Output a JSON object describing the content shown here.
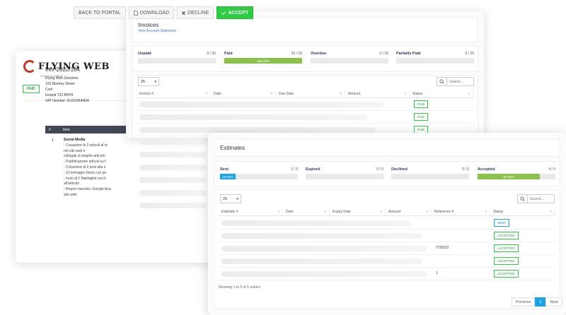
{
  "toolbar": {
    "back_label": "BACK TO PORTAL",
    "download_label": "DOWNLOAD",
    "decline_label": "DECLINE",
    "accept_label": "ACCEPT"
  },
  "invoice_doc": {
    "logo_text": "FLYING WEB",
    "logo_sub": "SOLUTIONS",
    "status": "PAID",
    "number": "INV-2022/104",
    "company_name": "Flying Web Solutions",
    "address_lines": [
      "103 Blarney Street",
      "Cork",
      "Ireland T23 R8Y8",
      "VAT Number: IE1020644DA"
    ],
    "table_headers": [
      "#",
      "Item"
    ],
    "row_num": "1",
    "item_title": "Social Media",
    "item_lines": [
      "- Creazione di 2 articoli al m",
      "nel sito web e",
      "collegati al singolo articolo",
      "- Pubblicazione articoli su f",
      "- Creazione di 2 post alla s",
      "- 10 immagini Stock con pe",
      "- Invio di 1 Mailinglist con li",
      "all'articolo",
      "- Report mensile i Google Ana",
      "sito web"
    ]
  },
  "invoices": {
    "title": "Invoices",
    "subtitle": "View Account Statement",
    "stats": [
      {
        "label": "Unpaid",
        "count": "0 / 26",
        "percent": 0,
        "text": ""
      },
      {
        "label": "Paid",
        "count": "26 / 26",
        "percent": 100,
        "text": "100.00%"
      },
      {
        "label": "Overdue",
        "count": "0 / 26",
        "percent": 0,
        "text": ""
      },
      {
        "label": "Partially Paid",
        "count": "0 / 26",
        "percent": 0,
        "text": ""
      }
    ],
    "page_length": "25",
    "search_placeholder": "Search...",
    "columns": [
      "Invoice #",
      "Date",
      "Due Date",
      "Amount",
      "Status"
    ],
    "statuses": [
      "PAID",
      "PAID",
      "PAID"
    ]
  },
  "estimates": {
    "title": "Estimates",
    "stats": [
      {
        "label": "Sent",
        "count": "1 / 5",
        "percent": 20,
        "text": "20.00%"
      },
      {
        "label": "Expired",
        "count": "0 / 5",
        "percent": 0,
        "text": ""
      },
      {
        "label": "Declined",
        "count": "0 / 5",
        "percent": 0,
        "text": ""
      },
      {
        "label": "Accepted",
        "count": "4 / 5",
        "percent": 80,
        "text": "80.00%"
      }
    ],
    "page_length": "25",
    "search_placeholder": "Search...",
    "columns": [
      "Estimate #",
      "Date",
      "Expiry Date",
      "Amount",
      "Reference #",
      "Status"
    ],
    "rows": [
      {
        "reference": "",
        "status": "SENT"
      },
      {
        "reference": "",
        "status": "ACCEPTED"
      },
      {
        "reference": "IT00032",
        "status": "ACCEPTED"
      },
      {
        "reference": "",
        "status": "ACCEPTED"
      },
      {
        "reference": "1",
        "status": "ACCEPTED"
      }
    ],
    "showing": "Showing 1 to 5 of 5 entries",
    "pager": {
      "prev": "Previous",
      "page": "1",
      "next": "Next"
    }
  },
  "colors": {
    "accent_blue": "#1ba3e6",
    "accept_green": "#2ecc40",
    "progress_green": "#8bc34a"
  }
}
